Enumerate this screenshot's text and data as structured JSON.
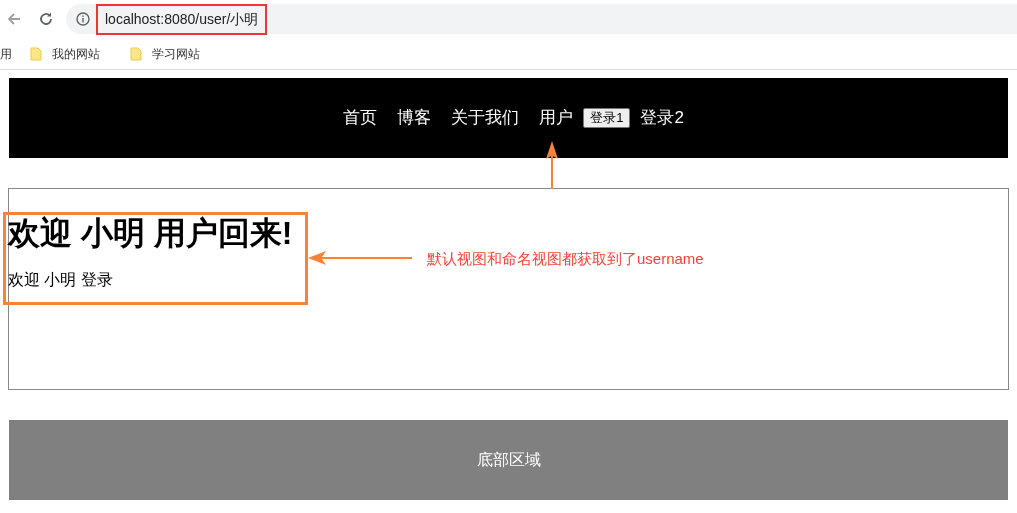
{
  "browser": {
    "url": "localhost:8080/user/小明",
    "bookmarks": [
      {
        "kind": "apps",
        "label": "用"
      },
      {
        "kind": "folder",
        "label": "我的网站"
      },
      {
        "kind": "folder",
        "label": "学习网站"
      }
    ]
  },
  "nav": [
    {
      "kind": "link",
      "label": "首页"
    },
    {
      "kind": "link",
      "label": "博客"
    },
    {
      "kind": "link",
      "label": "关于我们"
    },
    {
      "kind": "link",
      "label": "用户"
    },
    {
      "kind": "button",
      "label": "登录1"
    },
    {
      "kind": "link",
      "label": "登录2"
    }
  ],
  "content": {
    "heading": "欢迎 小明 用户回来!",
    "text": "欢迎 小明 登录"
  },
  "annotation": "默认视图和命名视图都获取到了username",
  "footer": "底部区域"
}
